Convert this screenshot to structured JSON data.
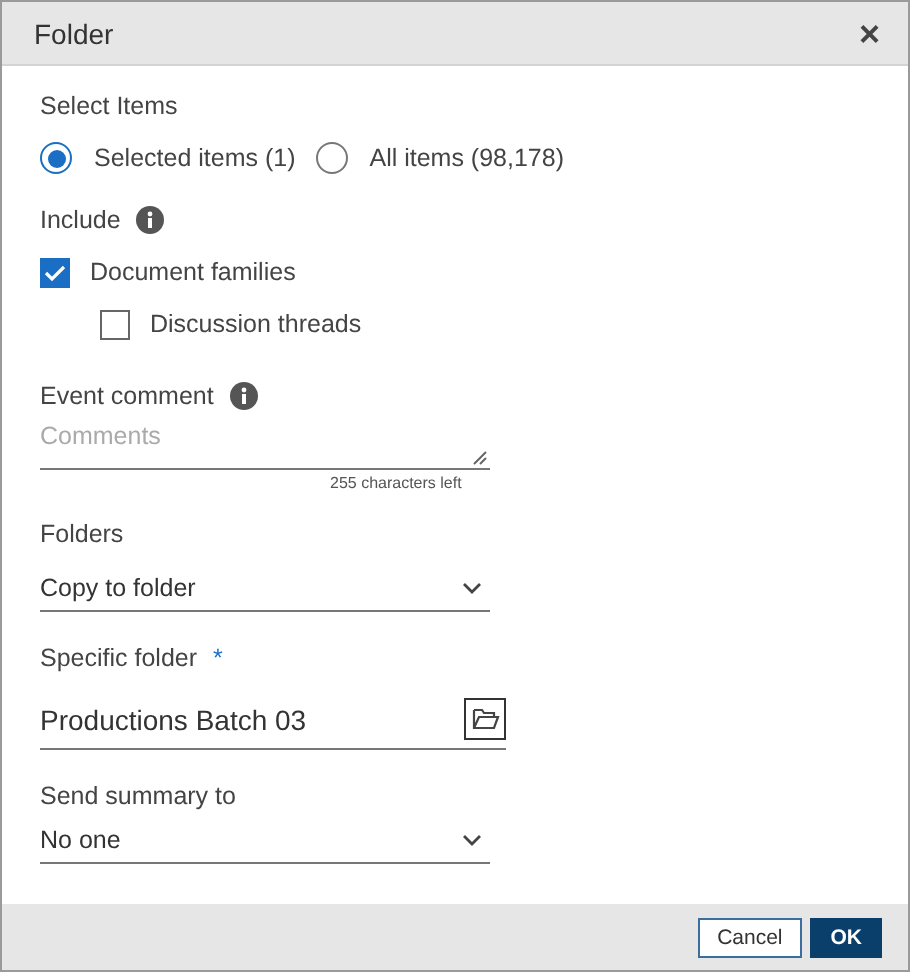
{
  "dialog": {
    "title": "Folder",
    "close": "×"
  },
  "select_items": {
    "label": "Select Items",
    "options": [
      {
        "label": "Selected items (1)",
        "selected": true
      },
      {
        "label": "All items (98,178)",
        "selected": false
      }
    ]
  },
  "include": {
    "label": "Include",
    "options": [
      {
        "label": "Document families",
        "checked": true,
        "children": [
          {
            "label": "Discussion threads",
            "checked": false
          }
        ]
      }
    ]
  },
  "event_comment": {
    "label": "Event comment",
    "placeholder": "Comments",
    "counter": "255 characters left"
  },
  "folders": {
    "label": "Folders",
    "value": "Copy to folder"
  },
  "specific_folder": {
    "label": "Specific folder",
    "required": "*",
    "value": "Productions Batch 03"
  },
  "send_summary": {
    "label": "Send summary to",
    "value": "No one"
  },
  "buttons": [
    {
      "label": "Cancel",
      "kind": "secondary"
    },
    {
      "label": "OK",
      "kind": "primary"
    }
  ]
}
